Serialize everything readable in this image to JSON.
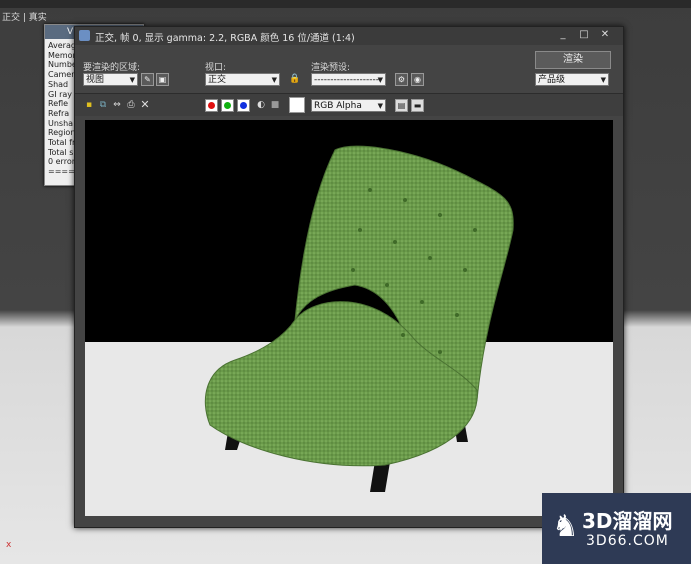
{
  "viewport": {
    "label": "正交 | 真实",
    "axis": "x"
  },
  "log_window": {
    "title": "V",
    "lines": [
      "Average",
      "Memory",
      "Number",
      "Camer",
      "Shad",
      "GI ray",
      "Refle",
      "Refra",
      "Unsha",
      "Region",
      "Total fr",
      "Total s",
      "0 error",
      "======"
    ]
  },
  "frame_buffer": {
    "title": "正交, 帧 0, 显示 gamma: 2.2, RGBA 颜色 16 位/通道 (1:4)",
    "window_buttons": [
      "_",
      "□",
      "✕"
    ],
    "area_label": "要渲染的区域:",
    "area_value": "视图",
    "viewport_label": "视口:",
    "viewport_value": "正交",
    "preset_label": "渲染预设:",
    "preset_value": "--------------------",
    "render_button": "渲染",
    "quality_value": "产品级",
    "channel_value": "RGB Alpha"
  },
  "watermark": {
    "big": "3D溜溜网",
    "small": "3D66.COM"
  },
  "colors": {
    "chair_green": "#6a9a4a",
    "channel_red": "#e01010",
    "channel_green": "#10b010",
    "channel_blue": "#1030e0",
    "watermark_bg": "#2e3a55"
  }
}
